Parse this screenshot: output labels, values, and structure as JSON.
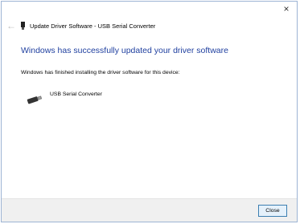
{
  "window": {
    "close_glyph": "×",
    "back_glyph": "←",
    "title": "Update Driver Software - USB Serial Converter"
  },
  "content": {
    "headline": "Windows has successfully updated your driver software",
    "subtext": "Windows has finished installing the driver software for this device:",
    "device_name": "USB Serial Converter"
  },
  "footer": {
    "close_label": "Close"
  },
  "colors": {
    "headline": "#1f3f9f",
    "footer_bg": "#f0f0f0",
    "button_border": "#3c7fb1",
    "button_bg": "#e5f1fb",
    "window_border": "#9db4d4"
  },
  "icons": {
    "title": "usb-plug-icon",
    "device": "usb-device-icon",
    "back": "back-arrow-icon",
    "close": "close-icon"
  }
}
